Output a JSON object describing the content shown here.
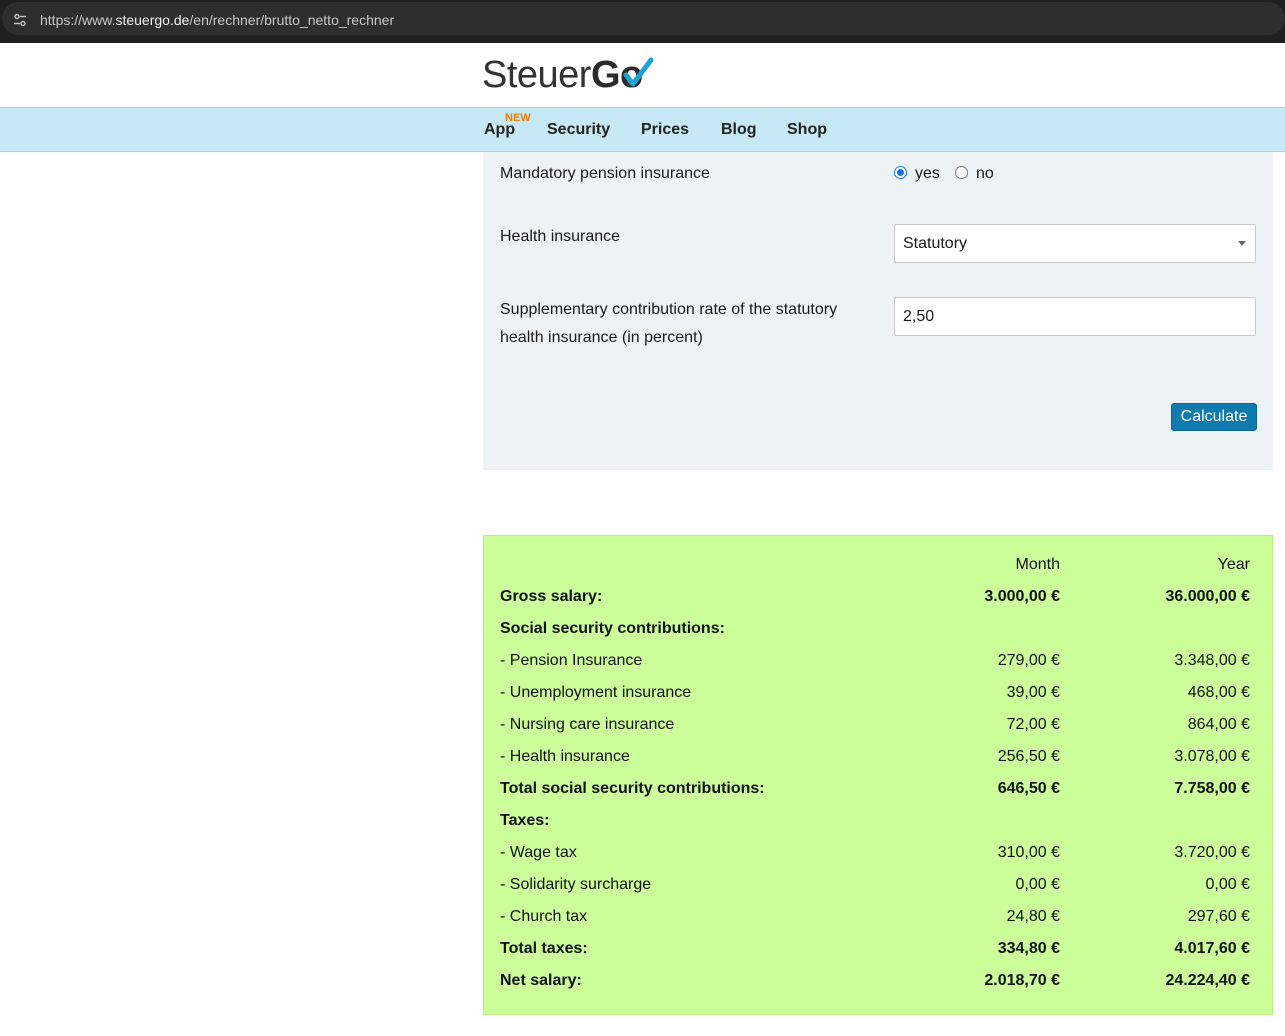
{
  "browser": {
    "url_scheme": "https://www.",
    "url_host": "steuergo.de",
    "url_path": "/en/rechner/brutto_netto_rechner"
  },
  "logo": {
    "part1": "Steuer",
    "part2": "Go"
  },
  "nav": {
    "badge": "NEW",
    "items": [
      "App",
      "Security",
      "Prices",
      "Blog",
      "Shop"
    ]
  },
  "form": {
    "pension_label": "Mandatory pension insurance",
    "pension_yes": "yes",
    "pension_no": "no",
    "pension_selected": "yes",
    "health_label": "Health insurance",
    "health_value": "Statutory",
    "supplement_label_line1": "Supplementary contribution rate of the statutory",
    "supplement_label_line2": "health insurance (in percent)",
    "supplement_value": "2,50",
    "calculate_label": "Calculate"
  },
  "results": {
    "header": {
      "month": "Month",
      "year": "Year"
    },
    "rows": [
      {
        "label": "Gross salary:",
        "month": "3.000,00 €",
        "year": "36.000,00 €",
        "bold": true
      },
      {
        "label": "Social security contributions:",
        "month": "",
        "year": "",
        "bold": true
      },
      {
        "label": "- Pension Insurance",
        "month": "279,00 €",
        "year": "3.348,00 €",
        "bold": false
      },
      {
        "label": "- Unemployment insurance",
        "month": "39,00 €",
        "year": "468,00 €",
        "bold": false
      },
      {
        "label": "- Nursing care insurance",
        "month": "72,00 €",
        "year": "864,00 €",
        "bold": false
      },
      {
        "label": "- Health insurance",
        "month": "256,50 €",
        "year": "3.078,00 €",
        "bold": false
      },
      {
        "label": "Total social security contributions:",
        "month": "646,50 €",
        "year": "7.758,00 €",
        "bold": true
      },
      {
        "label": "Taxes:",
        "month": "",
        "year": "",
        "bold": true
      },
      {
        "label": "- Wage tax",
        "month": "310,00 €",
        "year": "3.720,00 €",
        "bold": false
      },
      {
        "label": "- Solidarity surcharge",
        "month": "0,00 €",
        "year": "0,00 €",
        "bold": false
      },
      {
        "label": "- Church tax",
        "month": "24,80 €",
        "year": "297,60 €",
        "bold": false
      },
      {
        "label": "Total taxes:",
        "month": "334,80 €",
        "year": "4.017,60 €",
        "bold": true
      },
      {
        "label": "Net salary:",
        "month": "2.018,70 €",
        "year": "24.224,40 €",
        "bold": true
      }
    ]
  },
  "colors": {
    "nav_bg": "#c7e8f5",
    "form_bg": "#edf3f5",
    "results_bg": "#ccff99",
    "button_bg": "#0f7aad",
    "badge": "#f07d00",
    "logo_check": "#1aa3d6"
  }
}
